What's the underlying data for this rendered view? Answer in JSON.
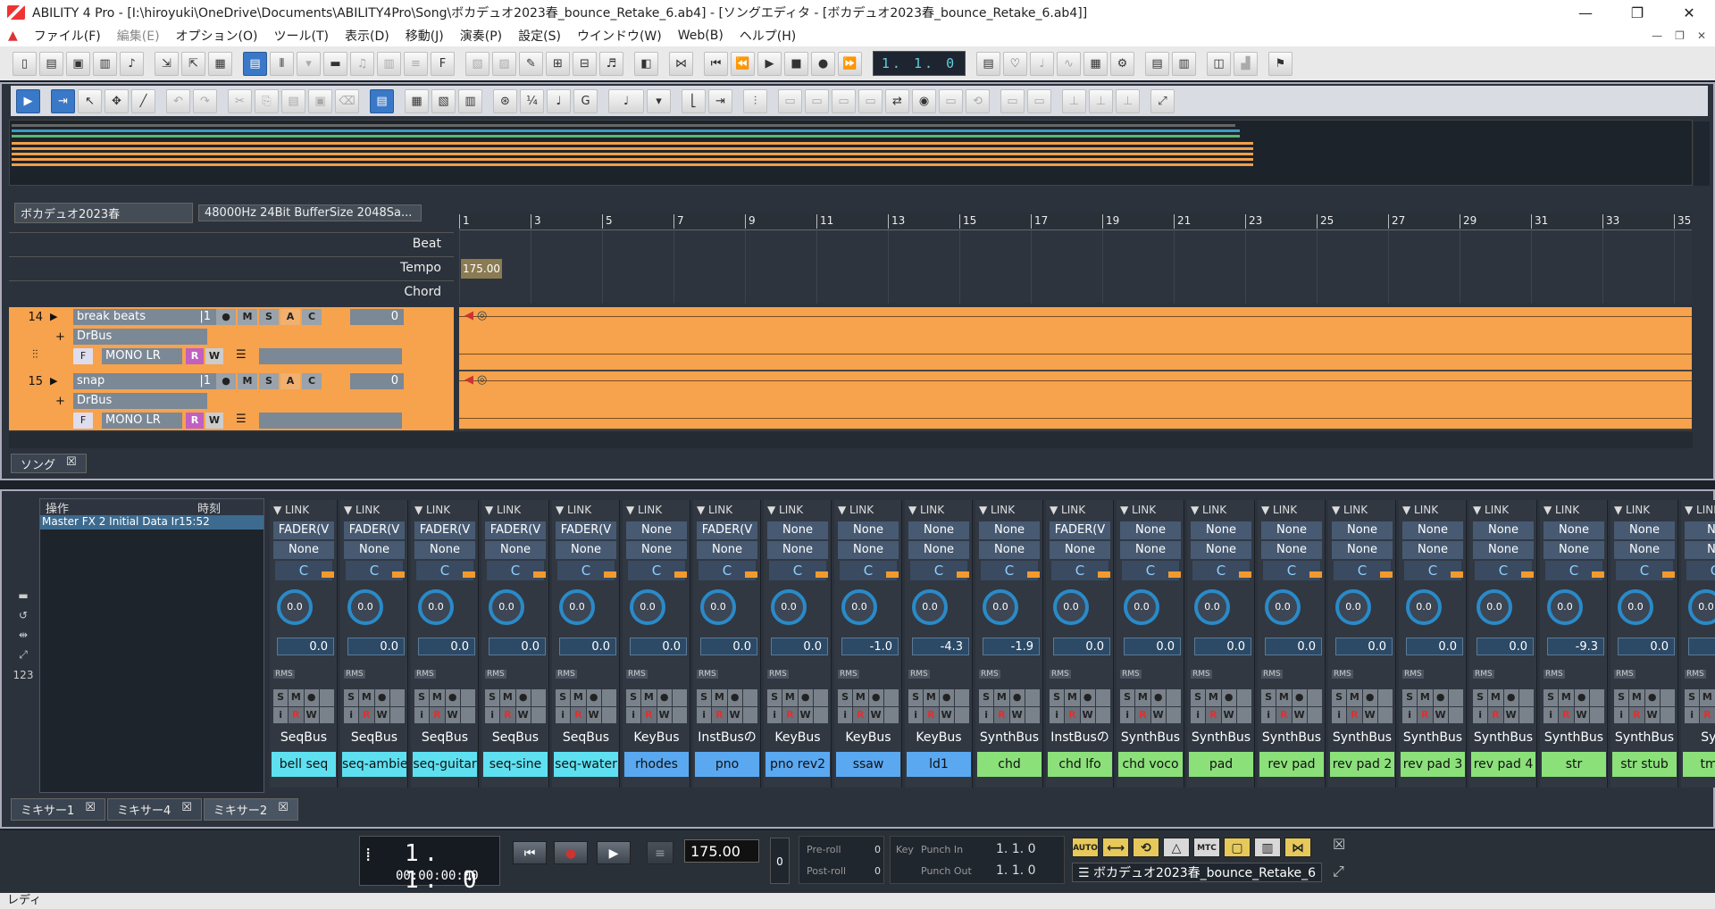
{
  "titlebar": {
    "title": "ABILITY 4 Pro - [I:\\hiroyuki\\OneDrive\\Documents\\ABILITY4Pro\\Song\\ボカデュオ2023春_bounce_Retake_6.ab4] - [ソングエディタ - [ボカデュオ2023春_bounce_Retake_6.ab4]]",
    "min": "—",
    "max": "❐",
    "close": "✕"
  },
  "menu": [
    "ファイル(F)",
    "編集(E)",
    "オプション(O)",
    "ツール(T)",
    "表示(D)",
    "移動(J)",
    "演奏(P)",
    "設定(S)",
    "ウインドウ(W)",
    "Web(B)",
    "ヘルプ(H)"
  ],
  "locator_top": "1. 1.  0",
  "song": {
    "name": "ボカデュオ2023春",
    "audio_info": "48000Hz 24Bit BufferSize 2048Sa...",
    "rows": {
      "beat": "Beat",
      "tempo": "Tempo",
      "chord": "Chord"
    },
    "tempo_value": "175.00",
    "bars": [
      "1",
      "3",
      "5",
      "7",
      "9",
      "11",
      "13",
      "15",
      "17",
      "19",
      "21",
      "23",
      "25",
      "27",
      "29",
      "31",
      "33",
      "35"
    ],
    "tab": "ソング"
  },
  "tracks": [
    {
      "num": "14",
      "name": "break beats",
      "ch": "|1",
      "bus": "DrBus",
      "io": "MONO LR",
      "vol": "0",
      "btns": [
        "●",
        "M",
        "S",
        "A",
        "C"
      ],
      "f": "F",
      "r": "R",
      "w": "W"
    },
    {
      "num": "15",
      "name": "snap",
      "ch": "|1",
      "bus": "DrBus",
      "io": "MONO LR",
      "vol": "0",
      "btns": [
        "●",
        "M",
        "S",
        "A",
        "C"
      ],
      "f": "F",
      "r": "R",
      "w": "W"
    }
  ],
  "history": {
    "col1": "操作",
    "col2": "時刻",
    "row": "Master FX 2 Initial Data Ir15:52"
  },
  "mixer": {
    "link": "▼ LINK",
    "rms": "RMS",
    "smb": [
      "S",
      "M",
      "●",
      "",
      "i",
      "R",
      "W",
      ""
    ],
    "strips": [
      {
        "ins": "FADER(V",
        "ins2": "None",
        "pan": "C",
        "knob": "0.0",
        "val": "0.0",
        "bus": "SeqBus",
        "name": "bell seq",
        "color": "#5ee0f0"
      },
      {
        "ins": "FADER(V",
        "ins2": "None",
        "pan": "C",
        "knob": "0.0",
        "val": "0.0",
        "bus": "SeqBus",
        "name": "seq-ambie",
        "color": "#5ee0f0"
      },
      {
        "ins": "FADER(V",
        "ins2": "None",
        "pan": "C",
        "knob": "0.0",
        "val": "0.0",
        "bus": "SeqBus",
        "name": "seq-guitar",
        "color": "#5ee0f0"
      },
      {
        "ins": "FADER(V",
        "ins2": "None",
        "pan": "C",
        "knob": "0.0",
        "val": "0.0",
        "bus": "SeqBus",
        "name": "seq-sine",
        "color": "#5ee0f0"
      },
      {
        "ins": "FADER(V",
        "ins2": "None",
        "pan": "C",
        "knob": "0.0",
        "val": "0.0",
        "bus": "SeqBus",
        "name": "seq-water",
        "color": "#5ee0f0"
      },
      {
        "ins": "None",
        "ins2": "None",
        "pan": "C",
        "knob": "0.0",
        "val": "0.0",
        "bus": "KeyBus",
        "name": "rhodes",
        "color": "#5aa8f0"
      },
      {
        "ins": "FADER(V",
        "ins2": "None",
        "pan": "C",
        "knob": "0.0",
        "val": "0.0",
        "bus": "InstBusの",
        "name": "pno",
        "color": "#5aa8f0"
      },
      {
        "ins": "None",
        "ins2": "None",
        "pan": "C",
        "knob": "0.0",
        "val": "0.0",
        "bus": "KeyBus",
        "name": "pno rev2",
        "color": "#5aa8f0"
      },
      {
        "ins": "None",
        "ins2": "None",
        "pan": "C",
        "knob": "0.0",
        "val": "-1.0",
        "bus": "KeyBus",
        "name": "ssaw",
        "color": "#5aa8f0"
      },
      {
        "ins": "None",
        "ins2": "None",
        "pan": "C",
        "knob": "0.0",
        "val": "-4.3",
        "bus": "KeyBus",
        "name": "ld1",
        "color": "#5aa8f0"
      },
      {
        "ins": "None",
        "ins2": "None",
        "pan": "C",
        "knob": "0.0",
        "val": "-1.9",
        "bus": "SynthBus",
        "name": "chd",
        "color": "#8be07a"
      },
      {
        "ins": "FADER(V",
        "ins2": "None",
        "pan": "C",
        "knob": "0.0",
        "val": "0.0",
        "bus": "InstBusの",
        "name": "chd lfo",
        "color": "#8be07a"
      },
      {
        "ins": "None",
        "ins2": "None",
        "pan": "C",
        "knob": "0.0",
        "val": "0.0",
        "bus": "SynthBus",
        "name": "chd voco",
        "color": "#8be07a"
      },
      {
        "ins": "None",
        "ins2": "None",
        "pan": "C",
        "knob": "0.0",
        "val": "0.0",
        "bus": "SynthBus",
        "name": "pad",
        "color": "#8be07a"
      },
      {
        "ins": "None",
        "ins2": "None",
        "pan": "C",
        "knob": "0.0",
        "val": "0.0",
        "bus": "SynthBus",
        "name": "rev pad",
        "color": "#8be07a"
      },
      {
        "ins": "None",
        "ins2": "None",
        "pan": "C",
        "knob": "0.0",
        "val": "0.0",
        "bus": "SynthBus",
        "name": "rev pad 2",
        "color": "#8be07a"
      },
      {
        "ins": "None",
        "ins2": "None",
        "pan": "C",
        "knob": "0.0",
        "val": "0.0",
        "bus": "SynthBus",
        "name": "rev pad 3",
        "color": "#8be07a"
      },
      {
        "ins": "None",
        "ins2": "None",
        "pan": "C",
        "knob": "0.0",
        "val": "0.0",
        "bus": "SynthBus",
        "name": "rev pad 4",
        "color": "#8be07a"
      },
      {
        "ins": "None",
        "ins2": "None",
        "pan": "C",
        "knob": "0.0",
        "val": "-9.3",
        "bus": "SynthBus",
        "name": "str",
        "color": "#8be07a"
      },
      {
        "ins": "None",
        "ins2": "None",
        "pan": "C",
        "knob": "0.0",
        "val": "0.0",
        "bus": "SynthBus",
        "name": "str stub",
        "color": "#8be07a"
      },
      {
        "ins": "No",
        "ins2": "No",
        "pan": "C",
        "knob": "0.0",
        "val": "",
        "bus": "Synt",
        "name": "tmp-",
        "color": "#8be07a"
      }
    ],
    "tabs": [
      "ミキサー1",
      "ミキサー4",
      "ミキサー2"
    ]
  },
  "transport": {
    "bars": "1. 1.  0",
    "time": "00:00:00:00",
    "tempo": "175.00",
    "beat": "0",
    "preroll_label": "Pre-roll",
    "preroll": "0",
    "postroll_label": "Post-roll",
    "postroll": "0",
    "key_label": "Key",
    "punchin_label": "Punch In",
    "punchin": "1. 1.  0",
    "punchout_label": "Punch Out",
    "punchout": "1. 1.  0",
    "buttons": [
      "AUTO STOP",
      "⟷",
      "⟲",
      "△",
      "MTC OFF",
      "▢",
      "▥",
      "⋈"
    ],
    "song_name": "ボカデュオ2023春_bounce_Retake_6"
  },
  "status": "レディ"
}
